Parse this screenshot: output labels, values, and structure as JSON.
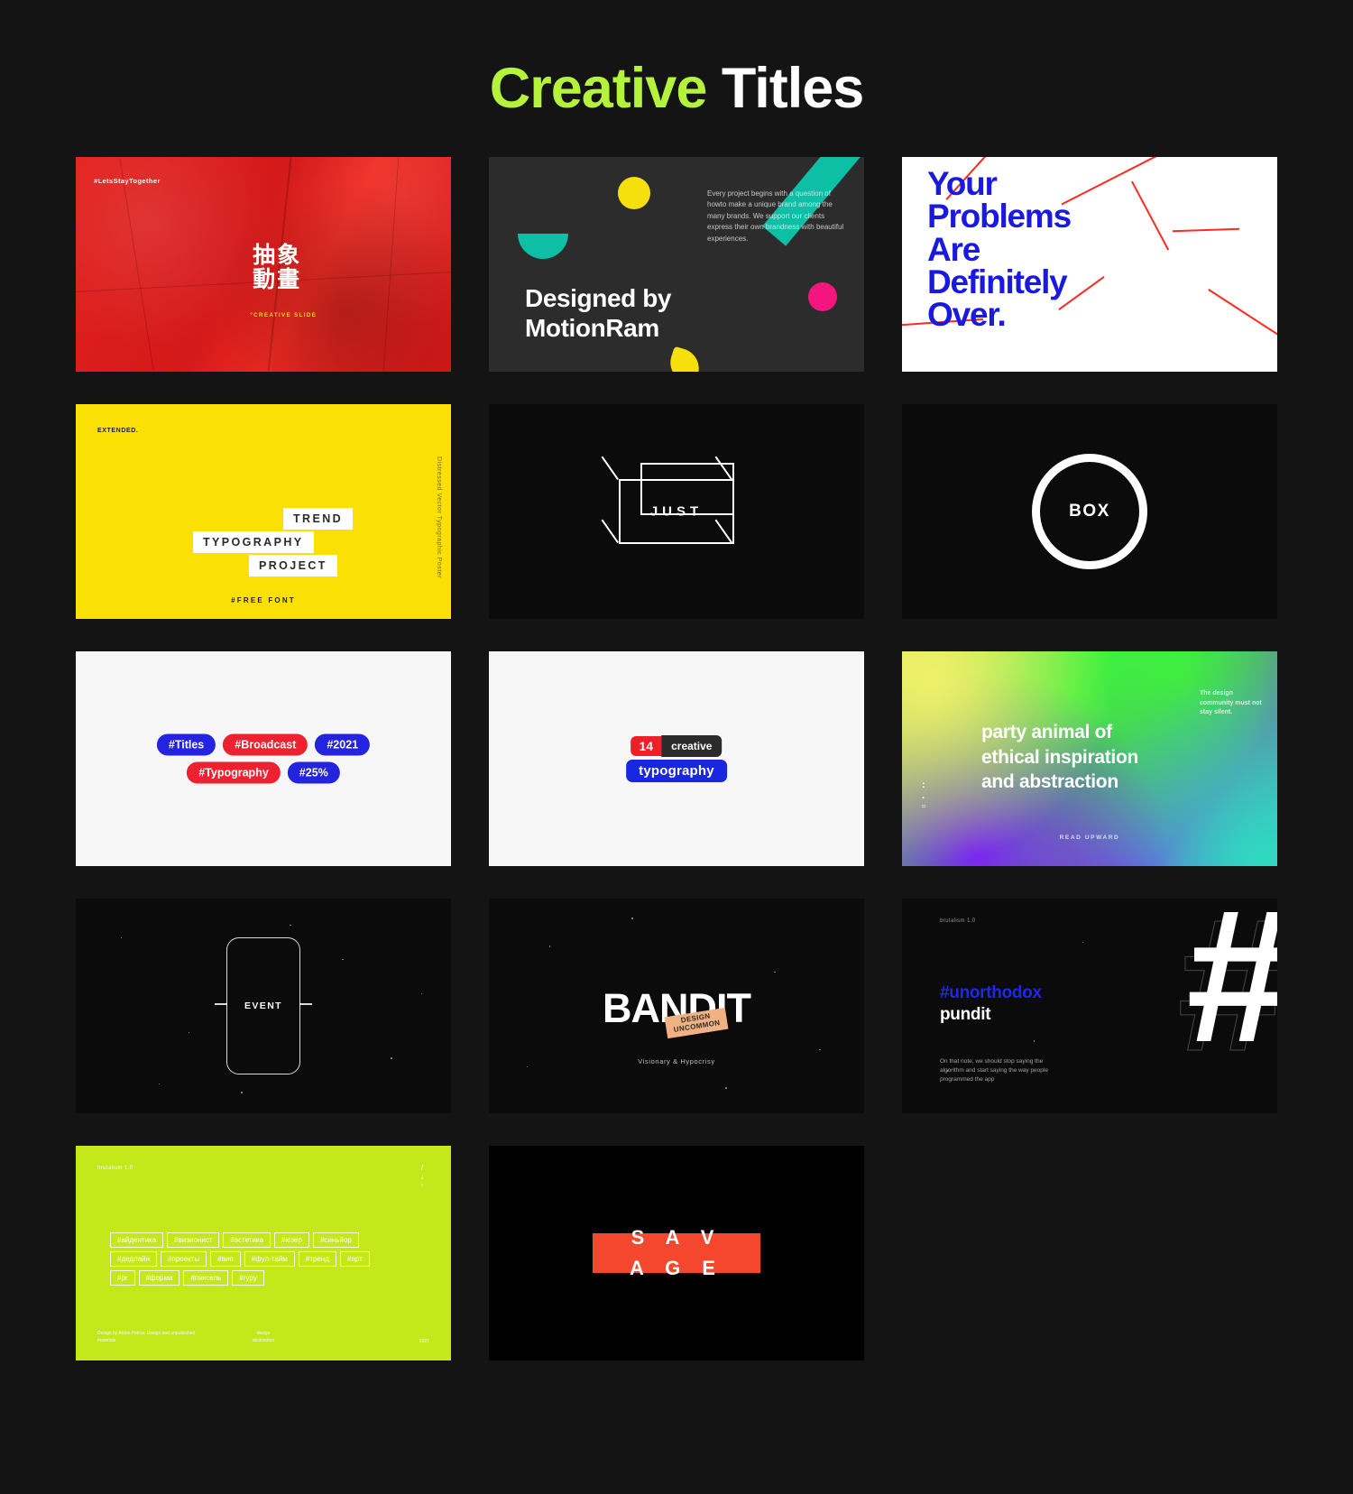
{
  "header": {
    "title_accent": "Creative",
    "title_rest": " Titles",
    "accent_color": "#b4f23c"
  },
  "cards": [
    {
      "id": "red-crumpled-slide",
      "tag": "#LetsStayTogether",
      "title": "抽象\n動畫",
      "subtitle": "°CREATIVE SLIDE",
      "bg_color": "#d4191a"
    },
    {
      "id": "designed-by-motionram",
      "heading": "Designed by\nMotionRam",
      "body": "Every project begins with a question of howto make a unique brand among the many brands. We support our clients express their own brandness with beautiful experiences.",
      "bg_color": "#2c2c2c",
      "shape_yellow": "#f5e00d",
      "shape_teal": "#0dbfa5",
      "shape_pink": "#f4157e"
    },
    {
      "id": "your-problems-are-over",
      "text": "Your\nProblems\nAre\nDefinitely\nOver.",
      "text_color": "#1a1adf",
      "line_color": "#ff2a20",
      "bg_color": "#ffffff"
    },
    {
      "id": "trend-typography-project",
      "kicker": "EXTENDED.",
      "line1": "TREND",
      "line2": "TYPOGRAPHY",
      "line3": "PROJECT",
      "footer": "#FREE FONT",
      "vertical": "Distressed Vector Typographic Poster",
      "bg_color": "#fbe006"
    },
    {
      "id": "just-3d-box",
      "label": "JUST",
      "bg_color": "#0b0b0b"
    },
    {
      "id": "box-circle",
      "label": "BOX",
      "bg_color": "#0b0b0b"
    },
    {
      "id": "hashtag-pills",
      "bg_color": "#f7f7f7",
      "rows": [
        [
          {
            "label": "#Titles",
            "color": "#2323e0"
          },
          {
            "label": "#Broadcast",
            "color": "#ee2130"
          },
          {
            "label": "#2021",
            "color": "#2323e0"
          }
        ],
        [
          {
            "label": "#Typography",
            "color": "#ee2130"
          },
          {
            "label": "#25%",
            "color": "#2323e0"
          }
        ]
      ]
    },
    {
      "id": "creative-typography-badges",
      "number": "14",
      "creative": "creative",
      "typography": "typography",
      "bg_color": "#f7f7f7",
      "num_color": "#ec2028",
      "creative_color": "#2b2b2b",
      "typo_color": "#1a27e0"
    },
    {
      "id": "party-animal-gradient",
      "heading": "party animal of\nethical inspiration\nand abstraction",
      "note": "The design community must not stay silent.",
      "footer": "READ UPWARD",
      "dots": ":\n.\n▫"
    },
    {
      "id": "event-phone",
      "label": "EVENT",
      "bg_color": "#0b0b0b"
    },
    {
      "id": "bandit-title",
      "title": "BANDIT",
      "label": "DESIGN\nUNCOMMON",
      "subtitle": "Visionary & Hypocrisy",
      "label_color": "#f2b183",
      "bg_color": "#0b0b0b"
    },
    {
      "id": "unorthodox-pundit",
      "kicker": "brutalism 1.0",
      "hashtag": "#unorthodox",
      "word": "pundit",
      "body": "On that note, we should stop saying the algorithm and start saying the way people programmed the app",
      "big_glyph": "#",
      "hash_color": "#1f28e8",
      "bg_color": "#0b0b0b"
    },
    {
      "id": "lime-russian-tags",
      "kicker": "brutalism 1.0",
      "marks": "/\n↓\n▫",
      "bg_color": "#c4e819",
      "tags": [
        "#айдентика",
        "#визионист",
        "#эстетика",
        "#юзер",
        "#синьйор",
        "#дедлайн",
        "#проекты",
        "#вип",
        "#фул-тайм",
        "#тренд",
        "#арт",
        "#pr",
        "#форма",
        "#пиксель",
        "#гуру"
      ],
      "footer_left": "Design by Anton Petrov. Design and unpublished materials",
      "footer_center": "design\nabstraction",
      "footer_right": "2021"
    },
    {
      "id": "savage-title",
      "text": "S A V\nA G E",
      "bar_color": "#f4472e",
      "bg_color": "#000000"
    }
  ]
}
